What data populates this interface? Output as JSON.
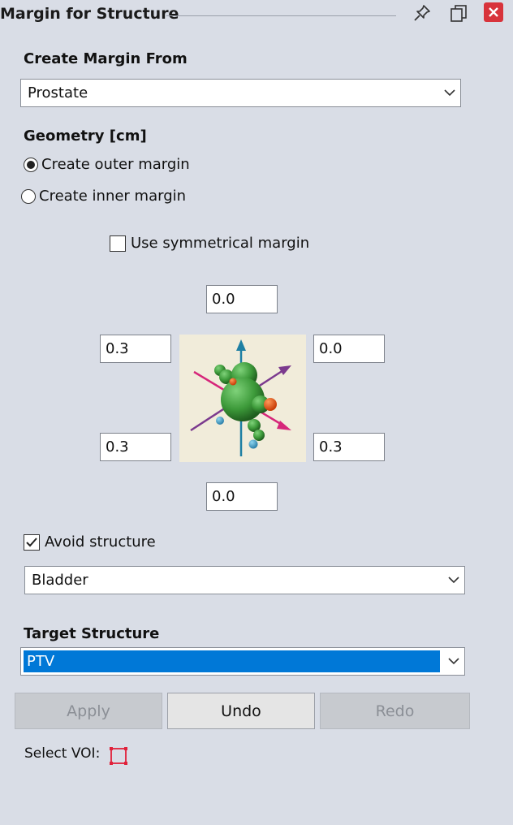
{
  "window": {
    "title": "Margin for Structure",
    "icons": [
      "pin-icon",
      "restore-icon",
      "close-icon"
    ]
  },
  "source": {
    "label": "Create Margin From",
    "value": "Prostate"
  },
  "geometry": {
    "label": "Geometry [cm]",
    "outer_label": "Create outer margin",
    "inner_label": "Create inner margin",
    "selected": "outer",
    "symmetric_label": "Use symmetrical margin",
    "symmetric_checked": false
  },
  "margins": {
    "top": "0.0",
    "upper_left": "0.3",
    "upper_right": "0.0",
    "lower_left": "0.3",
    "lower_right": "0.3",
    "bottom": "0.0"
  },
  "avoid": {
    "label": "Avoid structure",
    "checked": true,
    "value": "Bladder"
  },
  "target": {
    "label": "Target Structure",
    "value": "PTV"
  },
  "buttons": {
    "apply": "Apply",
    "undo": "Undo",
    "redo": "Redo"
  },
  "voi": {
    "label": "Select VOI:"
  },
  "colors": {
    "background": "#d9dde6",
    "selection": "#0078d7",
    "close": "#d8333b",
    "voi_icon": "#e0203a"
  }
}
